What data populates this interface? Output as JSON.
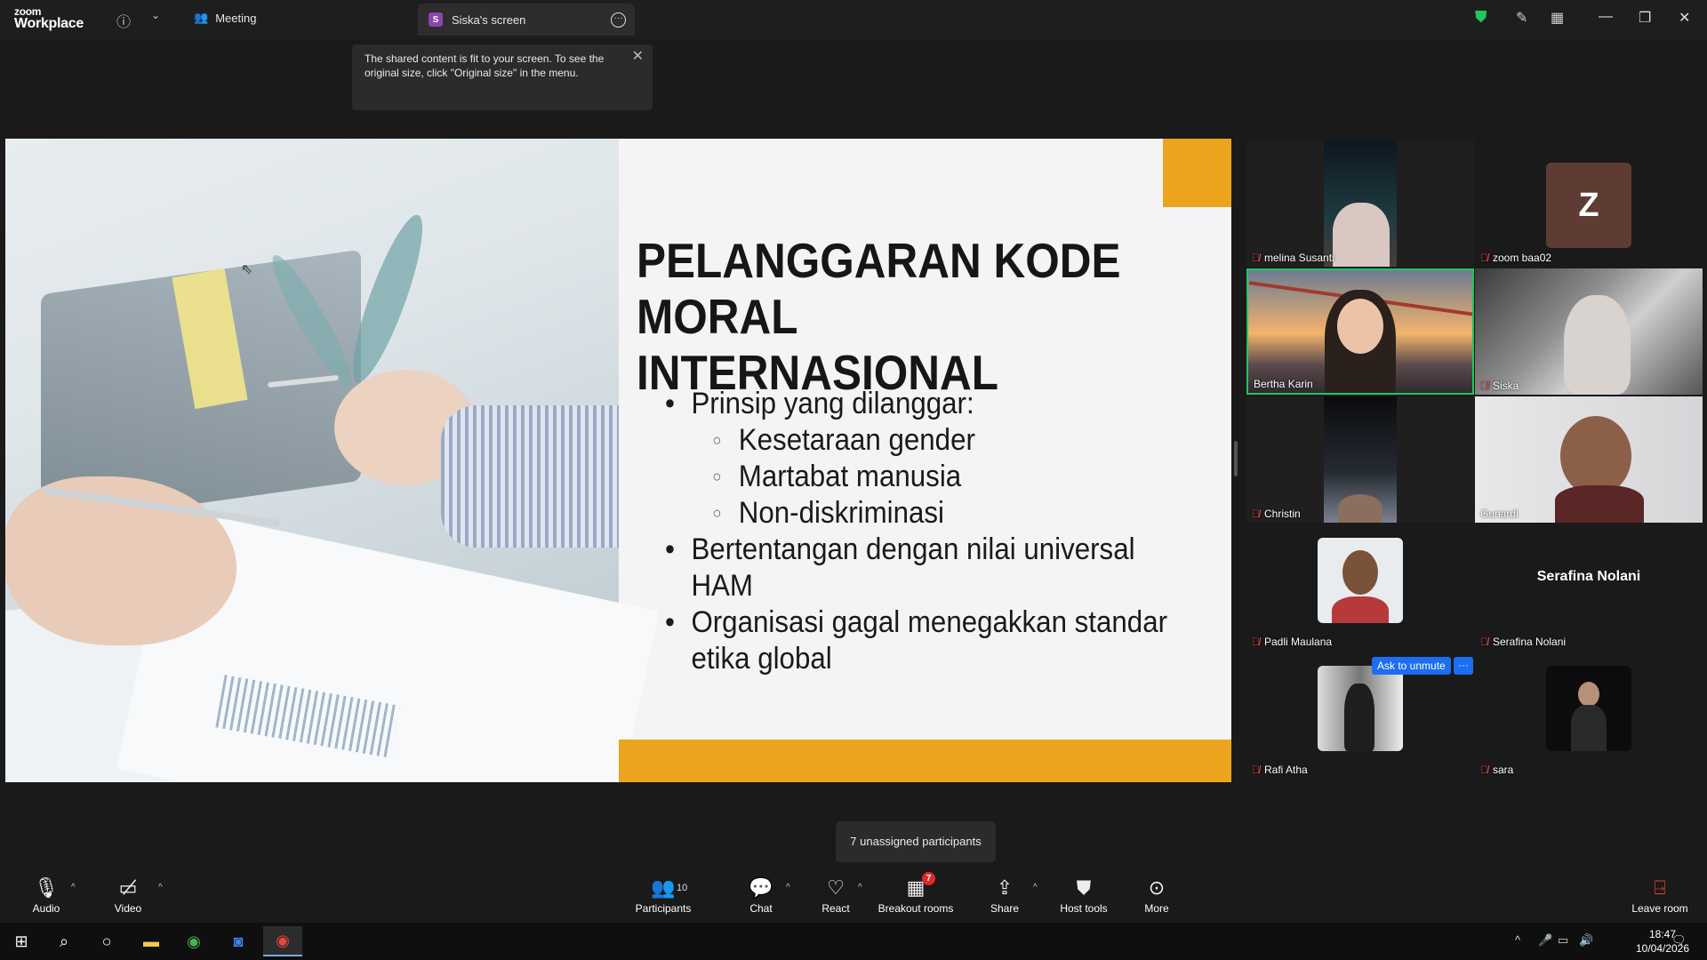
{
  "app": {
    "brand_small": "zoom",
    "brand_big": "Workplace"
  },
  "titlebar": {
    "meeting_label": "Meeting",
    "screen_tab_badge": "S",
    "screen_tab_label": "Siska's screen"
  },
  "tooltip": {
    "text": "The shared content is fit to your screen. To see the original size, click \"Original size\" in the menu."
  },
  "slide": {
    "title_line1": "PELANGGARAN KODE",
    "title_line2": "MORAL INTERNASIONAL",
    "bullet1": "Prinsip yang dilanggar:",
    "sub1": "Kesetaraan gender",
    "sub2": "Martabat manusia",
    "sub3": "Non-diskriminasi",
    "bullet2": "Bertentangan dengan nilai universal HAM",
    "bullet3": "Organisasi gagal menegakkan standar etika global",
    "accent_color": "#eca41f"
  },
  "gallery": {
    "p1": "melina Susanti",
    "p2": "zoom baa02",
    "p2_initial": "Z",
    "p3": "Bertha Karin",
    "p4": "Siska",
    "p5": "Christin",
    "p6": "Gunardi",
    "p7": "Padli Maulana",
    "p8": "Serafina Nolani",
    "p8_bigname": "Serafina Nolani",
    "p9": "Rafi Atha",
    "p10": "sara",
    "ask_unmute": "Ask to unmute",
    "ask_more": "···",
    "active_speaker_color": "#22c55e"
  },
  "unassigned_tooltip": "7 unassigned participants",
  "toolbar": {
    "audio": "Audio",
    "video": "Video",
    "participants": "Participants",
    "participants_count": "10",
    "chat": "Chat",
    "react": "React",
    "breakout": "Breakout rooms",
    "breakout_badge": "7",
    "share": "Share",
    "host_tools": "Host tools",
    "more": "More",
    "leave": "Leave room"
  },
  "taskbar": {
    "time": "18:47",
    "date": "10/04/2026"
  }
}
